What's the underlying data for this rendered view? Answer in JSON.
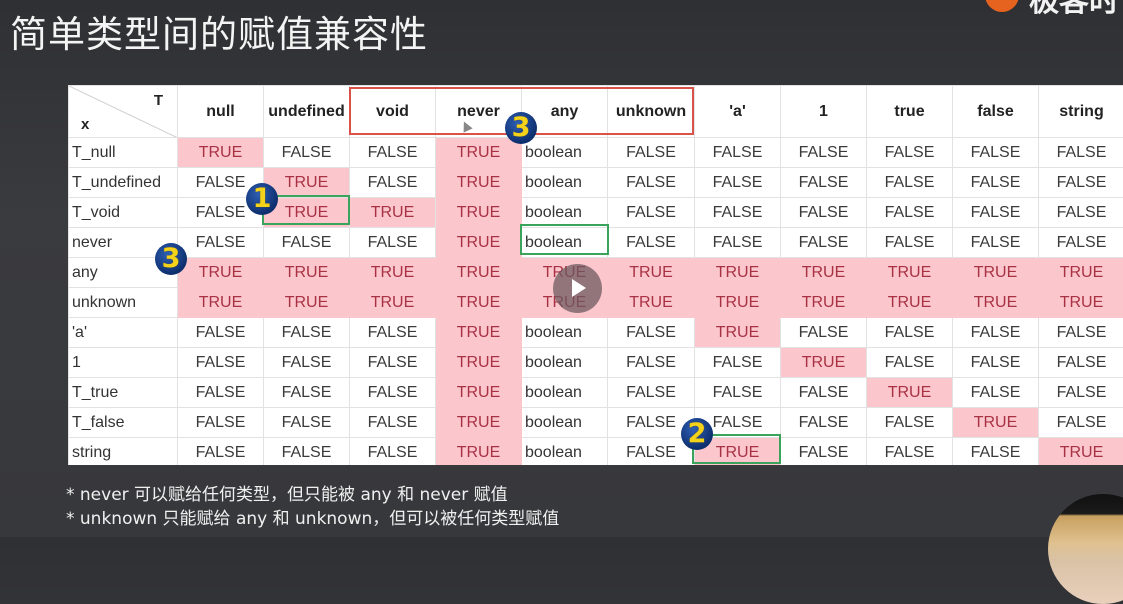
{
  "slide": {
    "title": "简单类型间的赋值兼容性",
    "logo_text": "极客时"
  },
  "table": {
    "corner": {
      "top_right": "T",
      "bottom_left": "x"
    },
    "columns": [
      "null",
      "undefined",
      "void",
      "never",
      "any",
      "unknown",
      "'a'",
      "1",
      "true",
      "false",
      "string"
    ],
    "rows": [
      {
        "label": "T_null",
        "cells": [
          "TRUE",
          "FALSE",
          "FALSE",
          "TRUE",
          "boolean",
          "FALSE",
          "FALSE",
          "FALSE",
          "FALSE",
          "FALSE",
          "FALSE"
        ]
      },
      {
        "label": "T_undefined",
        "cells": [
          "FALSE",
          "TRUE",
          "FALSE",
          "TRUE",
          "boolean",
          "FALSE",
          "FALSE",
          "FALSE",
          "FALSE",
          "FALSE",
          "FALSE"
        ]
      },
      {
        "label": "T_void",
        "cells": [
          "FALSE",
          "TRUE",
          "TRUE",
          "TRUE",
          "boolean",
          "FALSE",
          "FALSE",
          "FALSE",
          "FALSE",
          "FALSE",
          "FALSE"
        ]
      },
      {
        "label": "never",
        "cells": [
          "FALSE",
          "FALSE",
          "FALSE",
          "TRUE",
          "boolean",
          "FALSE",
          "FALSE",
          "FALSE",
          "FALSE",
          "FALSE",
          "FALSE"
        ]
      },
      {
        "label": "any",
        "cells": [
          "TRUE",
          "TRUE",
          "TRUE",
          "TRUE",
          "TRUE",
          "TRUE",
          "TRUE",
          "TRUE",
          "TRUE",
          "TRUE",
          "TRUE"
        ]
      },
      {
        "label": "unknown",
        "cells": [
          "TRUE",
          "TRUE",
          "TRUE",
          "TRUE",
          "TRUE",
          "TRUE",
          "TRUE",
          "TRUE",
          "TRUE",
          "TRUE",
          "TRUE"
        ]
      },
      {
        "label": "'a'",
        "cells": [
          "FALSE",
          "FALSE",
          "FALSE",
          "TRUE",
          "boolean",
          "FALSE",
          "TRUE",
          "FALSE",
          "FALSE",
          "FALSE",
          "FALSE"
        ]
      },
      {
        "label": "1",
        "cells": [
          "FALSE",
          "FALSE",
          "FALSE",
          "TRUE",
          "boolean",
          "FALSE",
          "FALSE",
          "TRUE",
          "FALSE",
          "FALSE",
          "FALSE"
        ]
      },
      {
        "label": "T_true",
        "cells": [
          "FALSE",
          "FALSE",
          "FALSE",
          "TRUE",
          "boolean",
          "FALSE",
          "FALSE",
          "FALSE",
          "TRUE",
          "FALSE",
          "FALSE"
        ]
      },
      {
        "label": "T_false",
        "cells": [
          "FALSE",
          "FALSE",
          "FALSE",
          "TRUE",
          "boolean",
          "FALSE",
          "FALSE",
          "FALSE",
          "FALSE",
          "TRUE",
          "FALSE"
        ]
      },
      {
        "label": "string",
        "cells": [
          "FALSE",
          "FALSE",
          "FALSE",
          "TRUE",
          "boolean",
          "FALSE",
          "TRUE",
          "FALSE",
          "FALSE",
          "FALSE",
          "TRUE"
        ]
      }
    ],
    "highlight_colors": {
      "true_bg": "#fbc6cc",
      "true_text": "#a83244",
      "box_red": "#d9534a",
      "box_green": "#3aa35c"
    }
  },
  "annotations": {
    "badges": [
      "1",
      "2",
      "3",
      "3"
    ]
  },
  "notes": [
    "* never 可以赋给任何类型，但只能被 any 和 never 赋值",
    "* unknown 只能赋给 any 和 unknown，但可以被任何类型赋值"
  ]
}
